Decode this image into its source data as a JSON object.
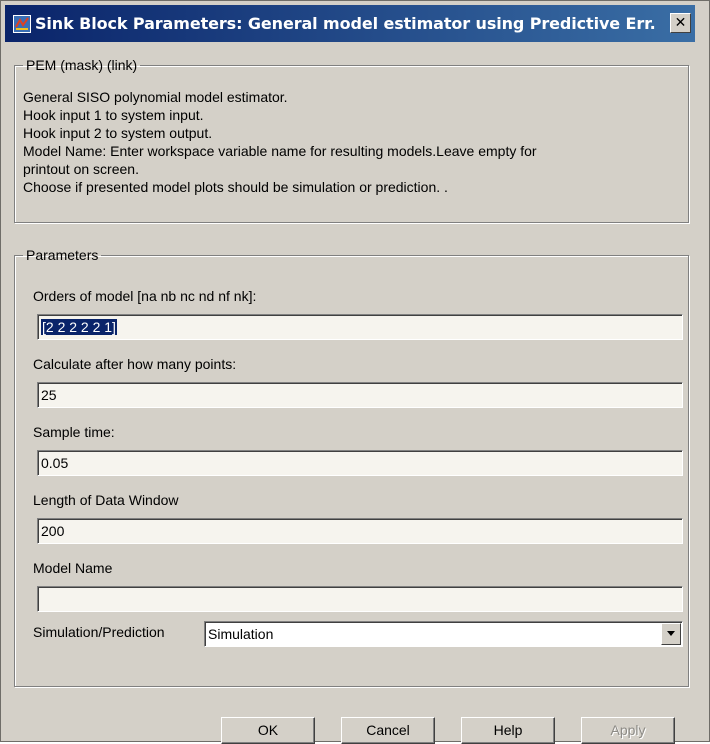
{
  "window": {
    "title": "Sink Block Parameters: General model estimator using Predictive Err...",
    "close_glyph": "✕"
  },
  "description": {
    "group_title": "PEM (mask) (link)",
    "lines": [
      "General SISO polynomial model estimator.",
      "Hook input 1 to system input.",
      "Hook input 2 to system output.",
      "Model Name: Enter workspace variable name for resulting models.Leave empty for",
      "printout on screen.",
      "Choose if presented model plots should be simulation or prediction. ."
    ]
  },
  "parameters": {
    "group_title": "Parameters",
    "fields": [
      {
        "label": "Orders of model [na nb nc nd nf nk]:",
        "value": "[2 2 2 2 2 1]"
      },
      {
        "label": "Calculate after how many points:",
        "value": "25"
      },
      {
        "label": "Sample time:",
        "value": "0.05"
      },
      {
        "label": "Length of Data Window",
        "value": "200"
      },
      {
        "label": "Model Name",
        "value": ""
      }
    ],
    "select": {
      "label": "Simulation/Prediction",
      "value": "Simulation"
    }
  },
  "buttons": {
    "ok": "OK",
    "cancel": "Cancel",
    "help": "Help",
    "apply": "Apply"
  },
  "icons": {
    "app": "simulink-block-icon",
    "close": "close-icon",
    "dropdown": "chevron-down-icon"
  },
  "colors": {
    "titlebar_start": "#0a246a",
    "titlebar_end": "#3a6ea5",
    "face": "#d4d0c8",
    "selection": "#0a246a"
  }
}
